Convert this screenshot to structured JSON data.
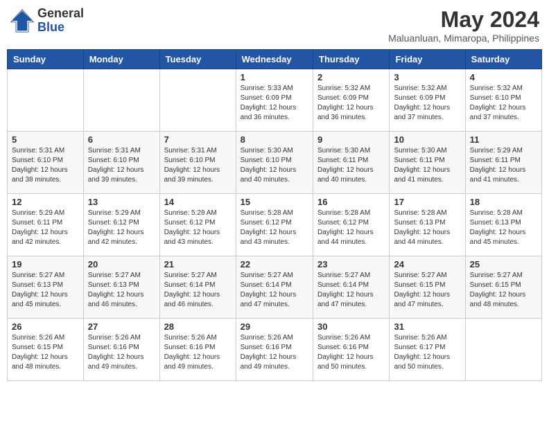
{
  "header": {
    "logo_general": "General",
    "logo_blue": "Blue",
    "month_year": "May 2024",
    "location": "Maluanluan, Mimaropa, Philippines"
  },
  "weekdays": [
    "Sunday",
    "Monday",
    "Tuesday",
    "Wednesday",
    "Thursday",
    "Friday",
    "Saturday"
  ],
  "weeks": [
    [
      {
        "day": "",
        "info": ""
      },
      {
        "day": "",
        "info": ""
      },
      {
        "day": "",
        "info": ""
      },
      {
        "day": "1",
        "info": "Sunrise: 5:33 AM\nSunset: 6:09 PM\nDaylight: 12 hours\nand 36 minutes."
      },
      {
        "day": "2",
        "info": "Sunrise: 5:32 AM\nSunset: 6:09 PM\nDaylight: 12 hours\nand 36 minutes."
      },
      {
        "day": "3",
        "info": "Sunrise: 5:32 AM\nSunset: 6:09 PM\nDaylight: 12 hours\nand 37 minutes."
      },
      {
        "day": "4",
        "info": "Sunrise: 5:32 AM\nSunset: 6:10 PM\nDaylight: 12 hours\nand 37 minutes."
      }
    ],
    [
      {
        "day": "5",
        "info": "Sunrise: 5:31 AM\nSunset: 6:10 PM\nDaylight: 12 hours\nand 38 minutes."
      },
      {
        "day": "6",
        "info": "Sunrise: 5:31 AM\nSunset: 6:10 PM\nDaylight: 12 hours\nand 39 minutes."
      },
      {
        "day": "7",
        "info": "Sunrise: 5:31 AM\nSunset: 6:10 PM\nDaylight: 12 hours\nand 39 minutes."
      },
      {
        "day": "8",
        "info": "Sunrise: 5:30 AM\nSunset: 6:10 PM\nDaylight: 12 hours\nand 40 minutes."
      },
      {
        "day": "9",
        "info": "Sunrise: 5:30 AM\nSunset: 6:11 PM\nDaylight: 12 hours\nand 40 minutes."
      },
      {
        "day": "10",
        "info": "Sunrise: 5:30 AM\nSunset: 6:11 PM\nDaylight: 12 hours\nand 41 minutes."
      },
      {
        "day": "11",
        "info": "Sunrise: 5:29 AM\nSunset: 6:11 PM\nDaylight: 12 hours\nand 41 minutes."
      }
    ],
    [
      {
        "day": "12",
        "info": "Sunrise: 5:29 AM\nSunset: 6:11 PM\nDaylight: 12 hours\nand 42 minutes."
      },
      {
        "day": "13",
        "info": "Sunrise: 5:29 AM\nSunset: 6:12 PM\nDaylight: 12 hours\nand 42 minutes."
      },
      {
        "day": "14",
        "info": "Sunrise: 5:28 AM\nSunset: 6:12 PM\nDaylight: 12 hours\nand 43 minutes."
      },
      {
        "day": "15",
        "info": "Sunrise: 5:28 AM\nSunset: 6:12 PM\nDaylight: 12 hours\nand 43 minutes."
      },
      {
        "day": "16",
        "info": "Sunrise: 5:28 AM\nSunset: 6:12 PM\nDaylight: 12 hours\nand 44 minutes."
      },
      {
        "day": "17",
        "info": "Sunrise: 5:28 AM\nSunset: 6:13 PM\nDaylight: 12 hours\nand 44 minutes."
      },
      {
        "day": "18",
        "info": "Sunrise: 5:28 AM\nSunset: 6:13 PM\nDaylight: 12 hours\nand 45 minutes."
      }
    ],
    [
      {
        "day": "19",
        "info": "Sunrise: 5:27 AM\nSunset: 6:13 PM\nDaylight: 12 hours\nand 45 minutes."
      },
      {
        "day": "20",
        "info": "Sunrise: 5:27 AM\nSunset: 6:13 PM\nDaylight: 12 hours\nand 46 minutes."
      },
      {
        "day": "21",
        "info": "Sunrise: 5:27 AM\nSunset: 6:14 PM\nDaylight: 12 hours\nand 46 minutes."
      },
      {
        "day": "22",
        "info": "Sunrise: 5:27 AM\nSunset: 6:14 PM\nDaylight: 12 hours\nand 47 minutes."
      },
      {
        "day": "23",
        "info": "Sunrise: 5:27 AM\nSunset: 6:14 PM\nDaylight: 12 hours\nand 47 minutes."
      },
      {
        "day": "24",
        "info": "Sunrise: 5:27 AM\nSunset: 6:15 PM\nDaylight: 12 hours\nand 47 minutes."
      },
      {
        "day": "25",
        "info": "Sunrise: 5:27 AM\nSunset: 6:15 PM\nDaylight: 12 hours\nand 48 minutes."
      }
    ],
    [
      {
        "day": "26",
        "info": "Sunrise: 5:26 AM\nSunset: 6:15 PM\nDaylight: 12 hours\nand 48 minutes."
      },
      {
        "day": "27",
        "info": "Sunrise: 5:26 AM\nSunset: 6:16 PM\nDaylight: 12 hours\nand 49 minutes."
      },
      {
        "day": "28",
        "info": "Sunrise: 5:26 AM\nSunset: 6:16 PM\nDaylight: 12 hours\nand 49 minutes."
      },
      {
        "day": "29",
        "info": "Sunrise: 5:26 AM\nSunset: 6:16 PM\nDaylight: 12 hours\nand 49 minutes."
      },
      {
        "day": "30",
        "info": "Sunrise: 5:26 AM\nSunset: 6:16 PM\nDaylight: 12 hours\nand 50 minutes."
      },
      {
        "day": "31",
        "info": "Sunrise: 5:26 AM\nSunset: 6:17 PM\nDaylight: 12 hours\nand 50 minutes."
      },
      {
        "day": "",
        "info": ""
      }
    ]
  ]
}
